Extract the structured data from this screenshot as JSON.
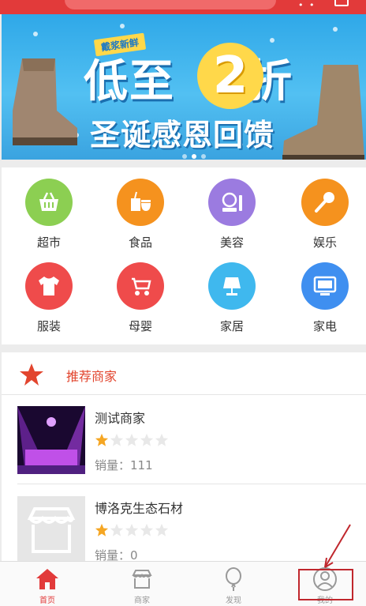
{
  "topbar": {
    "more_icon": "more-dots-icon",
    "message_icon": "message-icon"
  },
  "banner": {
    "tag": "戴浆新鲜",
    "headline_left": "低至",
    "headline_number": "2",
    "headline_right": "折",
    "subtitle": "圣诞感恩回馈",
    "slides": 3,
    "active_slide": 2,
    "colors": {
      "sky": "#2fa8e8",
      "accent": "#ffd84a"
    }
  },
  "categories": [
    {
      "label": "超市",
      "icon": "basket-icon",
      "color": "#8ccf52"
    },
    {
      "label": "食品",
      "icon": "food-icon",
      "color": "#f5921e"
    },
    {
      "label": "美容",
      "icon": "cosmetics-icon",
      "color": "#9b7be0"
    },
    {
      "label": "娱乐",
      "icon": "microphone-icon",
      "color": "#f5921e"
    },
    {
      "label": "服装",
      "icon": "tshirt-icon",
      "color": "#ef4b4b"
    },
    {
      "label": "母婴",
      "icon": "stroller-icon",
      "color": "#ef4b4b"
    },
    {
      "label": "家居",
      "icon": "lamp-icon",
      "color": "#3fb8ee"
    },
    {
      "label": "家电",
      "icon": "monitor-icon",
      "color": "#3f8ff0"
    }
  ],
  "recommended": {
    "title": "推荐商家",
    "merchants": [
      {
        "name": "测试商家",
        "rating": 1,
        "max_rating": 5,
        "sales_label": "销量：",
        "sales": "111",
        "thumb_icon": "stage-photo"
      },
      {
        "name": "博洛克生态石材",
        "rating": 1,
        "max_rating": 5,
        "sales_label": "销量：",
        "sales": "0",
        "thumb_icon": "storefront-icon"
      }
    ]
  },
  "nav": {
    "items": [
      {
        "label": "首页",
        "icon": "home-icon",
        "active": true
      },
      {
        "label": "商家",
        "icon": "shop-icon",
        "active": false
      },
      {
        "label": "发现",
        "icon": "balloon-icon",
        "active": false
      },
      {
        "label": "我的",
        "icon": "user-icon",
        "active": false
      }
    ],
    "accent": "#e23a3a"
  }
}
